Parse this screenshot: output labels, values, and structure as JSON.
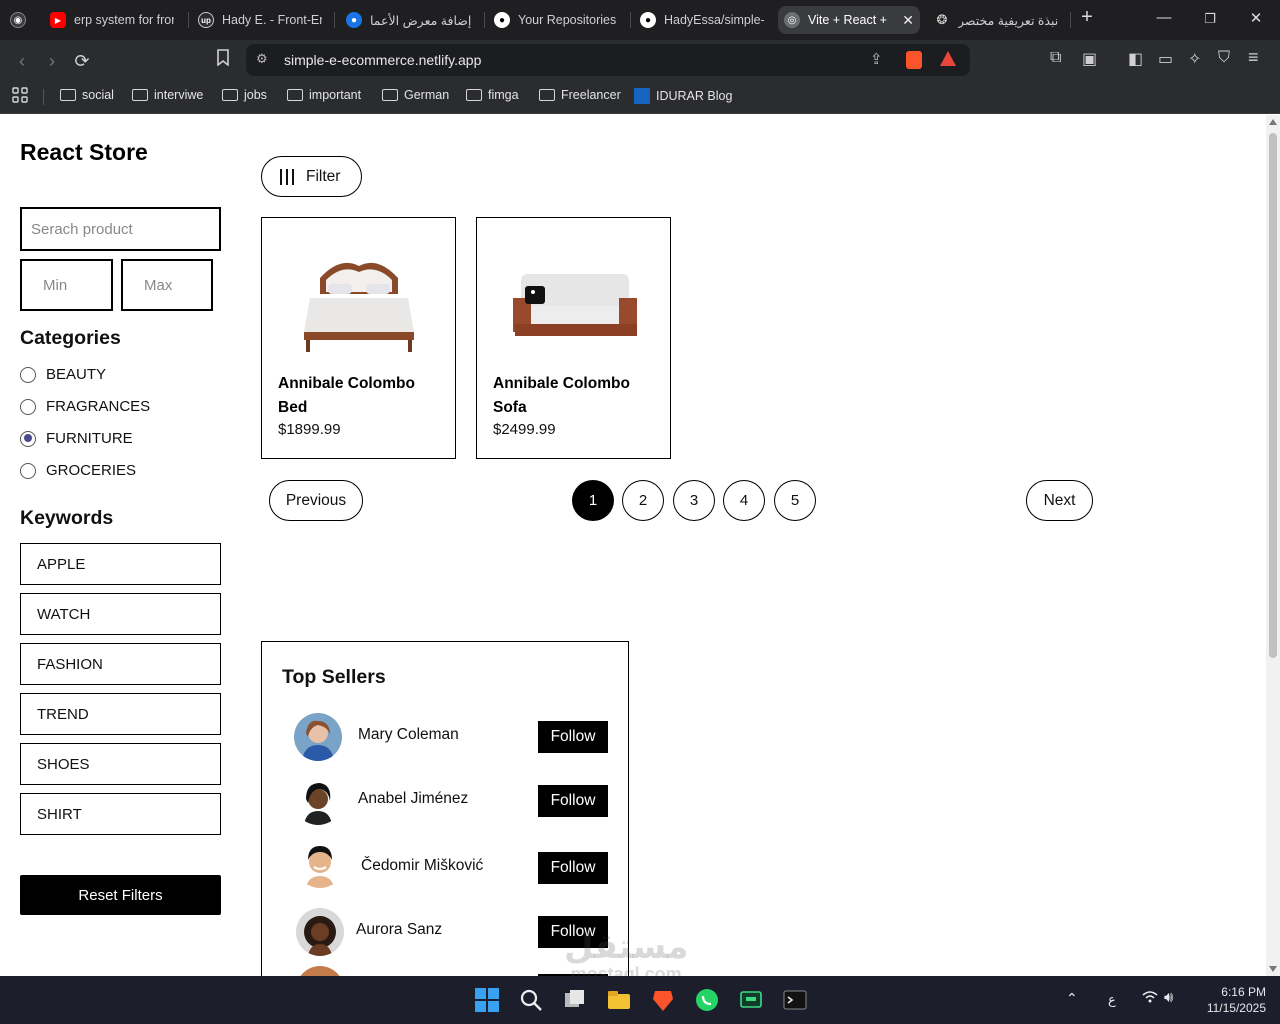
{
  "browser": {
    "tabs": [
      {
        "title": "erp system for fron",
        "icon": "youtube-icon",
        "color": "#ff0000"
      },
      {
        "title": "Hady E. - Front-En",
        "icon": "upwork-icon",
        "color": "#444"
      },
      {
        "title": "إضافة معرض الأعما",
        "icon": "mostaql-icon",
        "color": "#1a73e8"
      },
      {
        "title": "Your Repositories",
        "icon": "github-icon",
        "color": "#fff"
      },
      {
        "title": "HadyEssa/simple-E",
        "icon": "github-icon",
        "color": "#fff"
      },
      {
        "title": "Vite + React +",
        "icon": "globe-icon",
        "color": "#aaa"
      },
      {
        "title": "نبذة تعريفية مختصر",
        "icon": "chatgpt-icon",
        "color": "#fff"
      }
    ],
    "url": "simple-e-ecommerce.netlify.app",
    "bookmarks": [
      "social",
      "interviwe",
      "jobs",
      "important",
      "German",
      "fimga",
      "Freelancer",
      "IDURAR Blog"
    ]
  },
  "sidebar": {
    "title": "React Store",
    "search_placeholder": "Serach product",
    "min_placeholder": "Min",
    "max_placeholder": "Max",
    "categories_title": "Categories",
    "categories": [
      {
        "label": "BEAUTY",
        "checked": false
      },
      {
        "label": "FRAGRANCES",
        "checked": false
      },
      {
        "label": "FURNITURE",
        "checked": true
      },
      {
        "label": "GROCERIES",
        "checked": false
      }
    ],
    "keywords_title": "Keywords",
    "keywords": [
      "APPLE",
      "WATCH",
      "FASHION",
      "TREND",
      "SHOES",
      "SHIRT"
    ],
    "reset_label": "Reset Filters"
  },
  "main": {
    "filter_label": "Filter",
    "products": [
      {
        "name": "Annibale Colombo Bed",
        "price": "$1899.99",
        "image": "bed-image"
      },
      {
        "name": "Annibale Colombo Sofa",
        "price": "$2499.99",
        "image": "sofa-image"
      }
    ],
    "pagination": {
      "previous": "Previous",
      "next": "Next",
      "pages": [
        "1",
        "2",
        "3",
        "4",
        "5"
      ],
      "current": "1"
    }
  },
  "top_sellers": {
    "title": "Top Sellers",
    "sellers": [
      {
        "name": "Mary Coleman",
        "follow": "Follow"
      },
      {
        "name": "Anabel Jiménez",
        "follow": "Follow"
      },
      {
        "name": "Čedomir Mišković",
        "follow": "Follow"
      },
      {
        "name": "Aurora Sanz",
        "follow": "Follow"
      }
    ]
  },
  "watermark": {
    "line1": "مستقل",
    "line2": "mostaql.com"
  },
  "taskbar": {
    "time": "6:16 PM",
    "date": "11/15/2025",
    "keyboard_lang": "ع"
  }
}
